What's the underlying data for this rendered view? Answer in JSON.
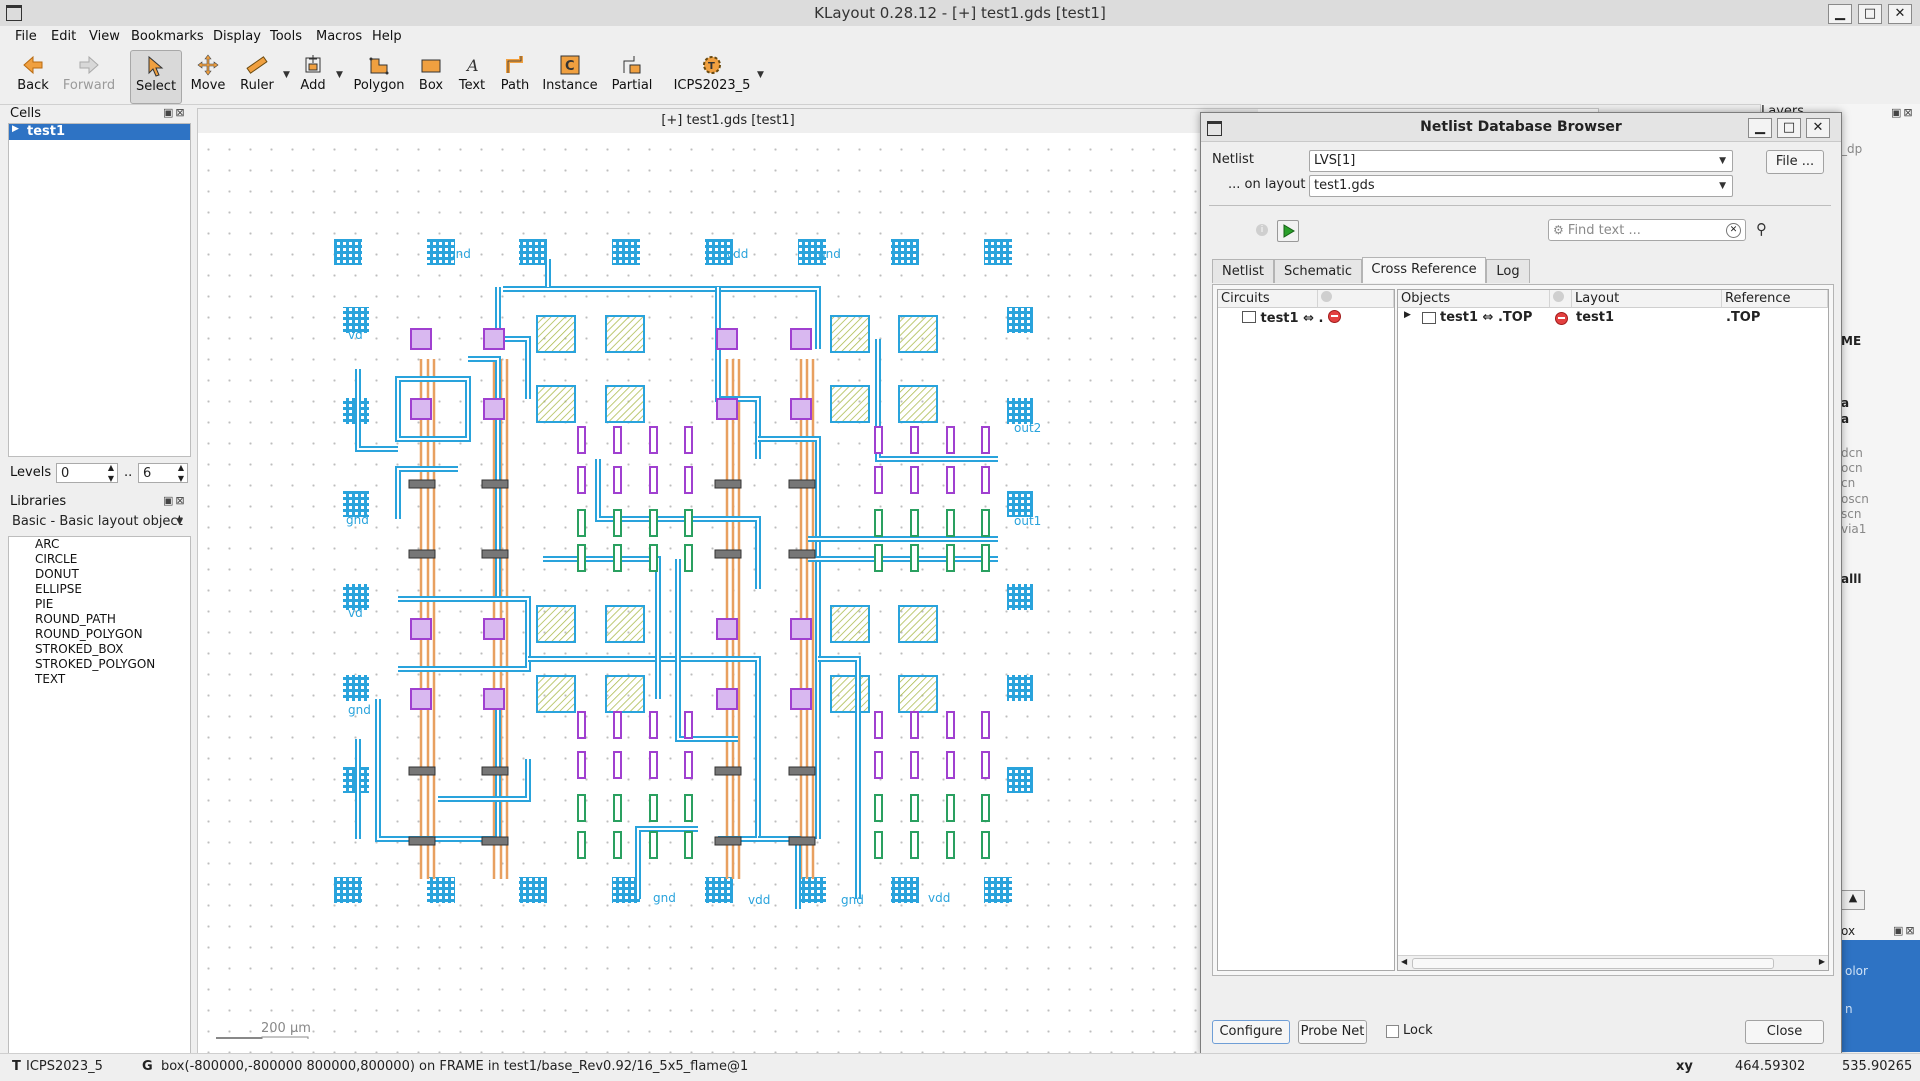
{
  "window": {
    "title": "KLayout 0.28.12 - [+] test1.gds [test1]"
  },
  "menu": [
    "File",
    "Edit",
    "View",
    "Bookmarks",
    "Display",
    "Tools",
    "Macros",
    "Help"
  ],
  "toolbar": {
    "back": "Back",
    "forward": "Forward",
    "select": "Select",
    "move": "Move",
    "ruler": "Ruler",
    "add": "Add",
    "polygon": "Polygon",
    "box": "Box",
    "text": "Text",
    "path": "Path",
    "instance": "Instance",
    "partial": "Partial",
    "tech": "ICPS2023_5"
  },
  "cells": {
    "title": "Cells",
    "selected": "test1"
  },
  "levels": {
    "label": "Levels",
    "from": "0",
    "sep": "..",
    "to": "6"
  },
  "libraries": {
    "title": "Libraries",
    "selected": "Basic - Basic layout object",
    "items": [
      "ARC",
      "CIRCLE",
      "DONUT",
      "ELLIPSE",
      "PIE",
      "ROUND_PATH",
      "ROUND_POLYGON",
      "STROKED_BOX",
      "STROKED_POLYGON",
      "TEXT"
    ]
  },
  "canvas": {
    "title": "[+] test1.gds [test1]",
    "scale": "200 μm",
    "labels": {
      "gnd": "gnd",
      "vdd": "vdd",
      "out1": "out1",
      "out2": "out2",
      "vd": "vd"
    }
  },
  "rightdock": {
    "title": "Layers",
    "frag": [
      "_dp",
      "ME",
      "a",
      "a",
      "dcn",
      "ocn",
      "cn",
      "oscn",
      "scn",
      "via1",
      "alll",
      "ox",
      "olor",
      "n"
    ]
  },
  "dialog": {
    "title": "Netlist Database Browser",
    "netlist_label": "Netlist",
    "netlist_value": "LVS[1]",
    "layout_label": "... on layout",
    "layout_value": "test1.gds",
    "file_button": "File ...",
    "find_placeholder": "Find text ...",
    "tabs": [
      "Netlist",
      "Schematic",
      "Cross Reference",
      "Log"
    ],
    "active_tab": "Cross Reference",
    "circuits_header": "Circuits",
    "circuit_row": "test1 ⇔ .",
    "objects_header": "Objects",
    "layout_header": "Layout",
    "reference_header": "Reference",
    "object_row": {
      "name": "test1 ⇔ .TOP",
      "layout": "test1",
      "reference": ".TOP"
    },
    "configure": "Configure",
    "probe": "Probe Net",
    "lock": "Lock",
    "close": "Close"
  },
  "status": {
    "tech_prefix": "T",
    "tech": "ICPS2023_5",
    "g": "G",
    "message": "box(-800000,-800000 800000,800000) on FRAME in test1/base_Rev0.92/16_5x5_flame@1",
    "xy_label": "xy",
    "x": "464.59302",
    "y": "535.90265"
  },
  "colors": {
    "accent": "#2e73c4",
    "wire": "#29a3dc",
    "poly": "#e8a060",
    "pad": "#6cc0ea"
  }
}
